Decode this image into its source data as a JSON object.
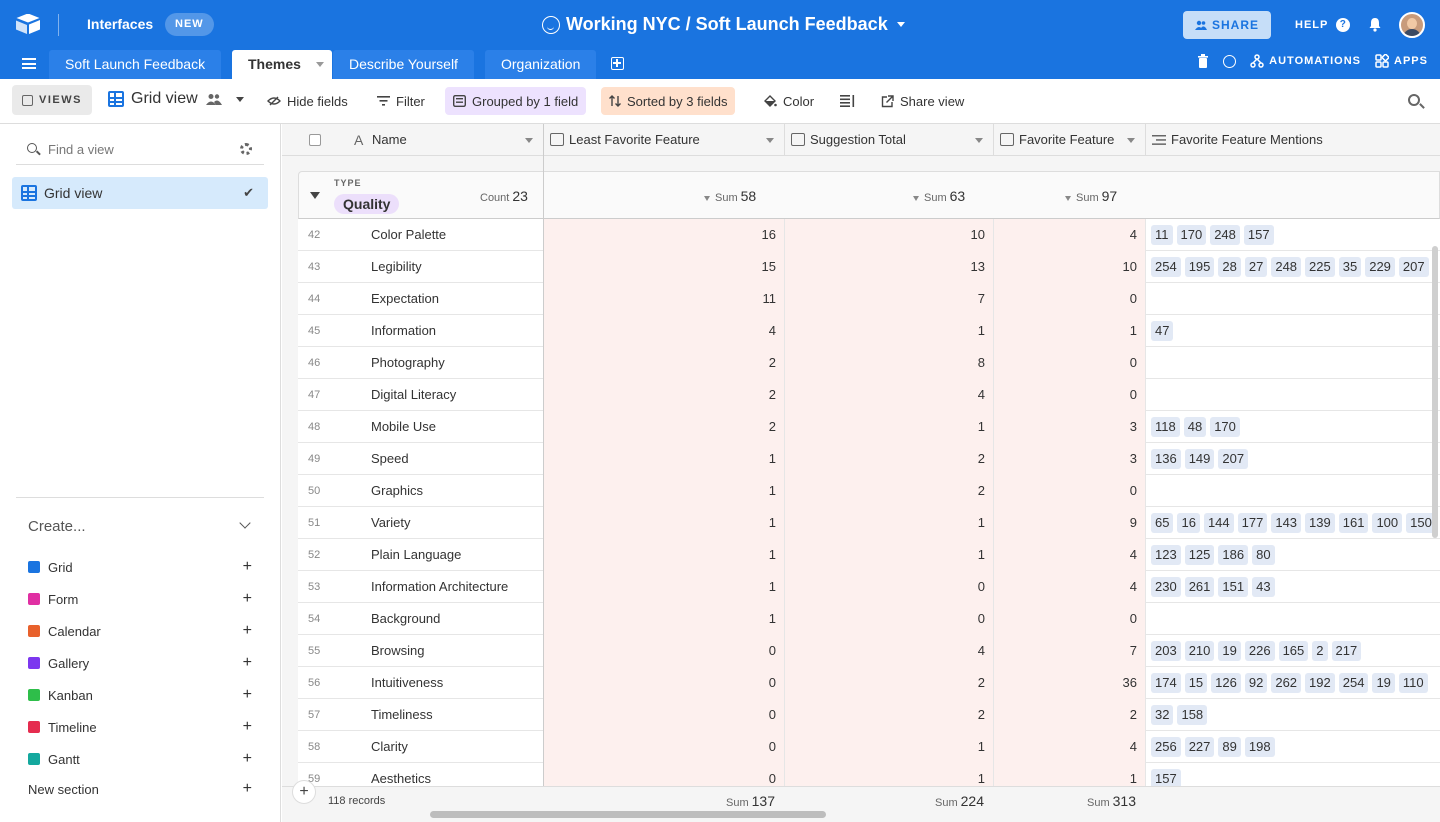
{
  "topbar": {
    "interfaces_label": "Interfaces",
    "new_badge": "NEW",
    "base_title": "Working NYC / Soft Launch Feedback",
    "share_label": "SHARE",
    "help_label": "HELP"
  },
  "tabs": [
    {
      "label": "Soft Launch Feedback"
    },
    {
      "label": "Themes"
    },
    {
      "label": "Describe Yourself"
    },
    {
      "label": "Organization"
    }
  ],
  "right_tools": {
    "automations_label": "AUTOMATIONS",
    "apps_label": "APPS"
  },
  "toolbar": {
    "views_label": "VIEWS",
    "view_name": "Grid view",
    "hide_fields": "Hide fields",
    "filter": "Filter",
    "grouped": "Grouped by 1 field",
    "sorted": "Sorted by 3 fields",
    "color": "Color",
    "share_view": "Share view"
  },
  "sidebar": {
    "find_placeholder": "Find a view",
    "active_view": "Grid view",
    "create_label": "Create...",
    "create_items": [
      {
        "label": "Grid",
        "color": "#1a74e0"
      },
      {
        "label": "Form",
        "color": "#e02fa3"
      },
      {
        "label": "Calendar",
        "color": "#e8612c"
      },
      {
        "label": "Gallery",
        "color": "#7c37ef"
      },
      {
        "label": "Kanban",
        "color": "#2ebe4a"
      },
      {
        "label": "Timeline",
        "color": "#e52c4f"
      },
      {
        "label": "Gantt",
        "color": "#14a89e"
      }
    ],
    "new_section": "New section"
  },
  "grid": {
    "columns": {
      "name": "Name",
      "least": "Least Favorite Feature",
      "suggestion": "Suggestion Total",
      "favorite": "Favorite Feature",
      "mentions": "Favorite Feature Mentions"
    },
    "group": {
      "type_label": "TYPE",
      "value": "Quality",
      "count_label": "Count",
      "count": "23",
      "sum_label": "Sum",
      "sum_least": "58",
      "sum_suggestion": "63",
      "sum_favorite": "97"
    },
    "rows": [
      {
        "num": "42",
        "name": "Color Palette",
        "least": "16",
        "suggestion": "10",
        "favorite": "4",
        "mentions": [
          "11",
          "170",
          "248",
          "157"
        ]
      },
      {
        "num": "43",
        "name": "Legibility",
        "least": "15",
        "suggestion": "13",
        "favorite": "10",
        "mentions": [
          "254",
          "195",
          "28",
          "27",
          "248",
          "225",
          "35",
          "229",
          "207"
        ]
      },
      {
        "num": "44",
        "name": "Expectation",
        "least": "11",
        "suggestion": "7",
        "favorite": "0",
        "mentions": []
      },
      {
        "num": "45",
        "name": "Information",
        "least": "4",
        "suggestion": "1",
        "favorite": "1",
        "mentions": [
          "47"
        ]
      },
      {
        "num": "46",
        "name": "Photography",
        "least": "2",
        "suggestion": "8",
        "favorite": "0",
        "mentions": []
      },
      {
        "num": "47",
        "name": "Digital Literacy",
        "least": "2",
        "suggestion": "4",
        "favorite": "0",
        "mentions": []
      },
      {
        "num": "48",
        "name": "Mobile Use",
        "least": "2",
        "suggestion": "1",
        "favorite": "3",
        "mentions": [
          "118",
          "48",
          "170"
        ]
      },
      {
        "num": "49",
        "name": "Speed",
        "least": "1",
        "suggestion": "2",
        "favorite": "3",
        "mentions": [
          "136",
          "149",
          "207"
        ]
      },
      {
        "num": "50",
        "name": "Graphics",
        "least": "1",
        "suggestion": "2",
        "favorite": "0",
        "mentions": []
      },
      {
        "num": "51",
        "name": "Variety",
        "least": "1",
        "suggestion": "1",
        "favorite": "9",
        "mentions": [
          "65",
          "16",
          "144",
          "177",
          "143",
          "139",
          "161",
          "100",
          "150"
        ]
      },
      {
        "num": "52",
        "name": "Plain Language",
        "least": "1",
        "suggestion": "1",
        "favorite": "4",
        "mentions": [
          "123",
          "125",
          "186",
          "80"
        ]
      },
      {
        "num": "53",
        "name": "Information Architecture",
        "least": "1",
        "suggestion": "0",
        "favorite": "4",
        "mentions": [
          "230",
          "261",
          "151",
          "43"
        ]
      },
      {
        "num": "54",
        "name": "Background",
        "least": "1",
        "suggestion": "0",
        "favorite": "0",
        "mentions": []
      },
      {
        "num": "55",
        "name": "Browsing",
        "least": "0",
        "suggestion": "4",
        "favorite": "7",
        "mentions": [
          "203",
          "210",
          "19",
          "226",
          "165",
          "2",
          "217"
        ]
      },
      {
        "num": "56",
        "name": "Intuitiveness",
        "least": "0",
        "suggestion": "2",
        "favorite": "36",
        "mentions": [
          "174",
          "15",
          "126",
          "92",
          "262",
          "192",
          "254",
          "19",
          "110"
        ]
      },
      {
        "num": "57",
        "name": "Timeliness",
        "least": "0",
        "suggestion": "2",
        "favorite": "2",
        "mentions": [
          "32",
          "158"
        ]
      },
      {
        "num": "58",
        "name": "Clarity",
        "least": "0",
        "suggestion": "1",
        "favorite": "4",
        "mentions": [
          "256",
          "227",
          "89",
          "198"
        ]
      },
      {
        "num": "59",
        "name": "Aesthetics",
        "least": "0",
        "suggestion": "1",
        "favorite": "1",
        "mentions": [
          "157"
        ]
      }
    ],
    "footer": {
      "records": "118 records",
      "sum_label": "Sum",
      "sum_least": "137",
      "sum_suggestion": "224",
      "sum_favorite": "313"
    }
  }
}
